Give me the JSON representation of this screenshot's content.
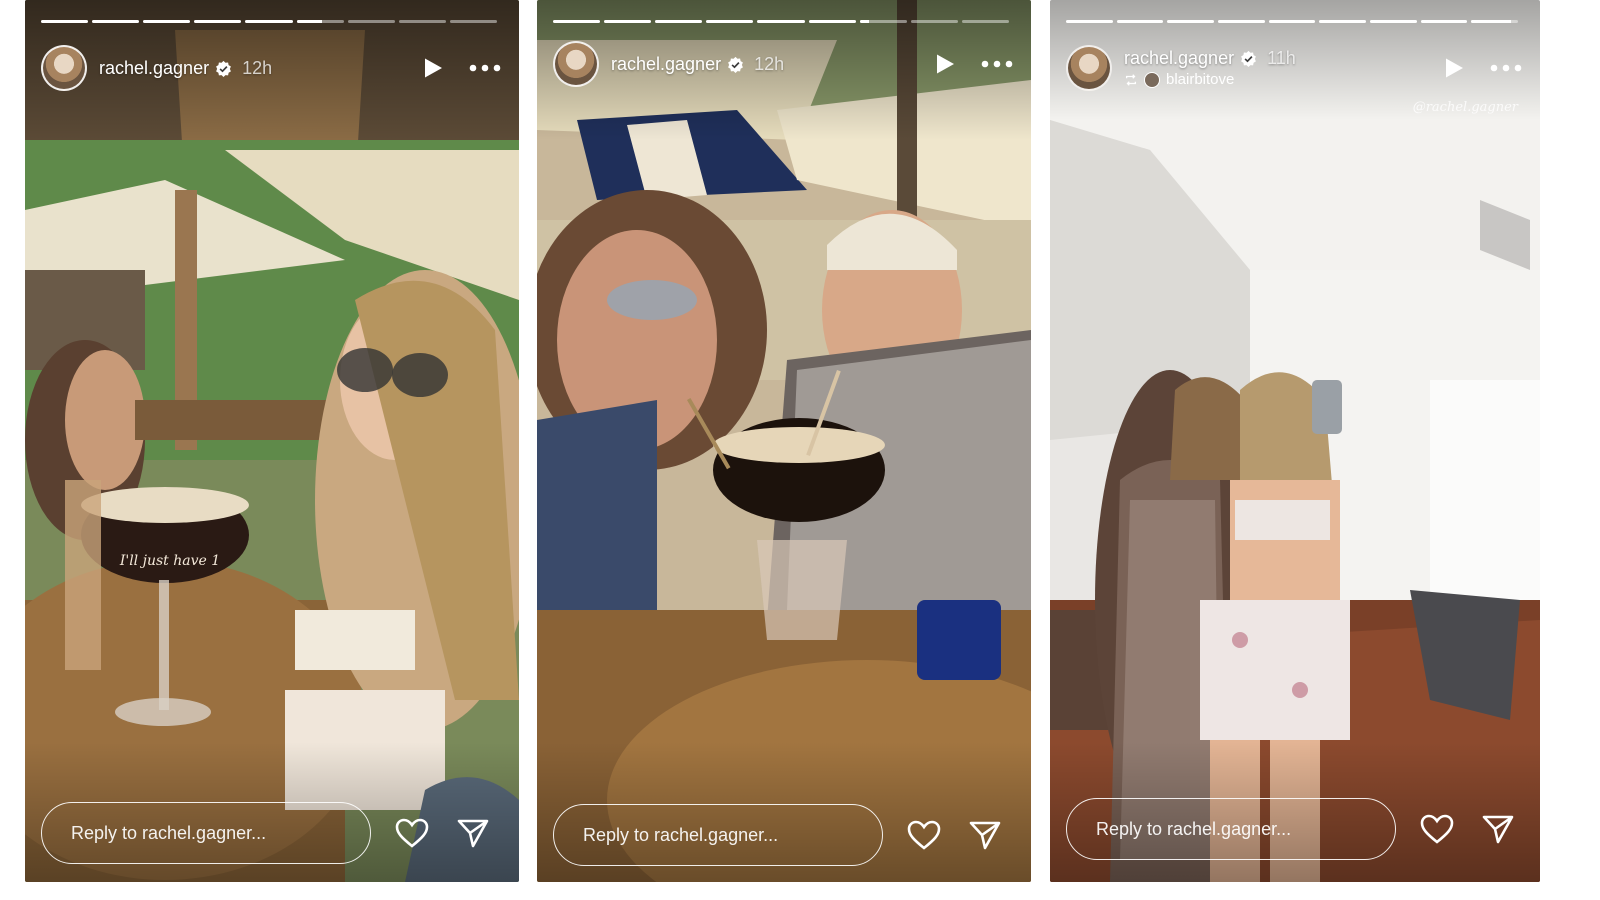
{
  "stories": [
    {
      "username": "rachel.gagner",
      "time": "12h",
      "reply_placeholder": "Reply to rachel.gagner...",
      "progress": [
        1,
        1,
        1,
        1,
        1,
        0.55,
        0,
        0,
        0
      ],
      "caption": "I'll just have 1"
    },
    {
      "username": "rachel.gagner",
      "time": "12h",
      "reply_placeholder": "Reply to rachel.gagner...",
      "progress": [
        1,
        1,
        1,
        1,
        1,
        1,
        0.2,
        0,
        0
      ]
    },
    {
      "username": "rachel.gagner",
      "time": "11h",
      "reposted_from": "blairbitove",
      "tag_overlay": "@rachel.gagner",
      "reply_placeholder": "Reply to rachel.gagner...",
      "progress": [
        1,
        1,
        1,
        1,
        1,
        1,
        1,
        1,
        0.85
      ]
    }
  ],
  "colors": {
    "ui_white": "#ffffff",
    "overlay_dark": "#000000"
  },
  "icons": [
    "verified-badge-icon",
    "play-icon",
    "more-icon",
    "heart-icon",
    "send-icon",
    "repost-icon"
  ]
}
